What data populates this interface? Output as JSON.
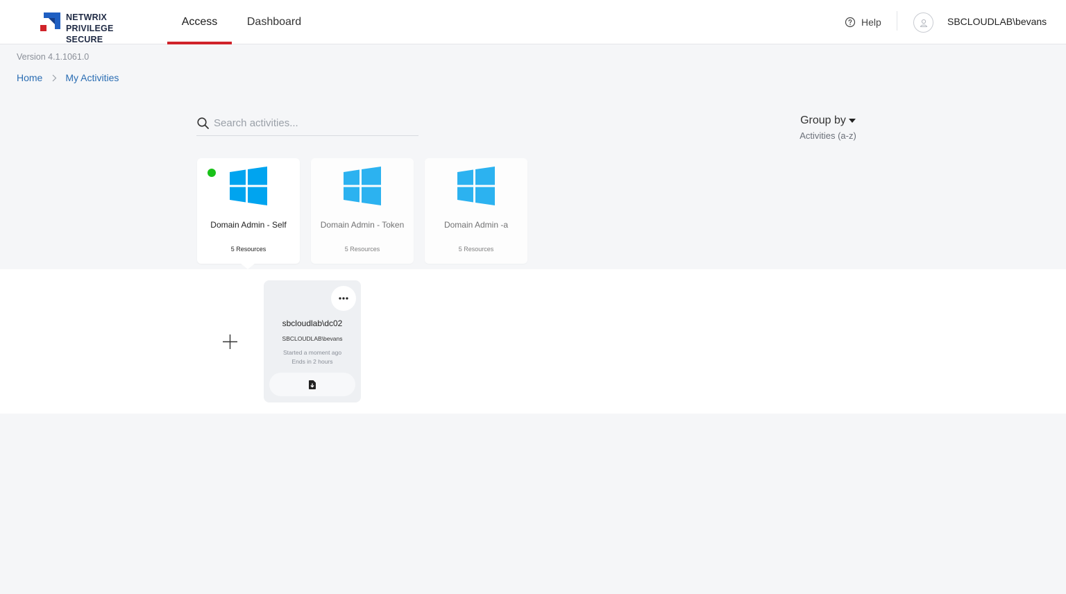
{
  "brand": {
    "line1": "NETWRIX",
    "line2": "PRIVILEGE SECURE"
  },
  "nav": {
    "tabs": [
      {
        "label": "Access",
        "active": true
      },
      {
        "label": "Dashboard",
        "active": false
      }
    ]
  },
  "header": {
    "help_label": "Help",
    "username": "SBCLOUDLAB\\bevans"
  },
  "version": "Version 4.1.1061.0",
  "breadcrumb": {
    "home": "Home",
    "current": "My Activities"
  },
  "search": {
    "placeholder": "Search activities...",
    "value": ""
  },
  "group_by": {
    "title": "Group by",
    "value": "Activities (a-z)"
  },
  "activities": [
    {
      "title": "Domain Admin - Self",
      "resources": "5 Resources",
      "active": true,
      "icon": "windows-icon"
    },
    {
      "title": "Domain Admin - Token",
      "resources": "5 Resources",
      "active": false,
      "icon": "windows-icon"
    },
    {
      "title": "Domain Admin -a",
      "resources": "5 Resources",
      "active": false,
      "icon": "windows-icon"
    }
  ],
  "session": {
    "host": "sbcloudlab\\dc02",
    "user": "SBCLOUDLAB\\bevans",
    "started": "Started a moment ago",
    "ends": "Ends in 2 hours"
  },
  "colors": {
    "accent": "#d0232a",
    "link": "#2a6db3",
    "active_dot": "#19c219",
    "windows_blue": "#00a4ef"
  }
}
